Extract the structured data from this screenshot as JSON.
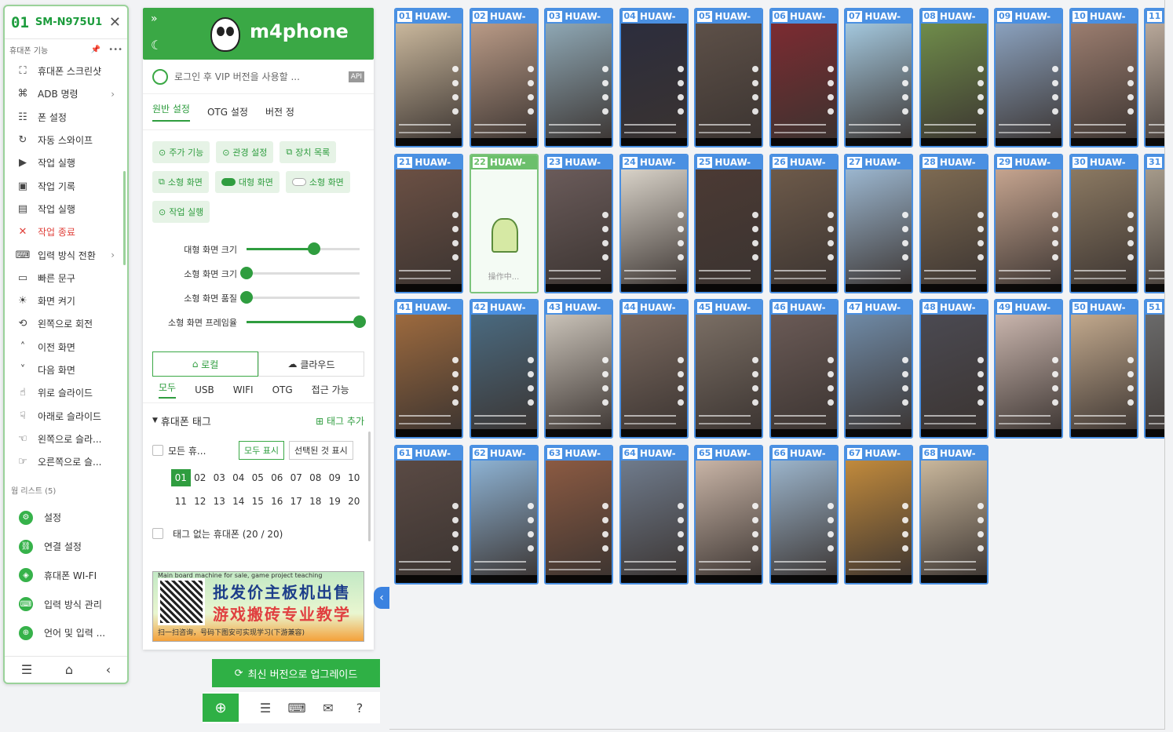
{
  "left_panel": {
    "device_num": "01",
    "device_model": "SM-N975U1",
    "close_icon": "close-icon",
    "subheader": "휴대폰 기능",
    "menu": [
      {
        "label": "휴대폰 스크린샷",
        "icon": "screenshot-icon"
      },
      {
        "label": "ADB 명령",
        "icon": "command-icon",
        "arrow": true
      },
      {
        "label": "폰 설정",
        "icon": "sliders-icon"
      },
      {
        "label": "자동 스와이프",
        "icon": "swipe-icon"
      },
      {
        "label": "작업 실행",
        "icon": "play-icon"
      },
      {
        "label": "작업 기록",
        "icon": "record-icon"
      },
      {
        "label": "작업 실행",
        "icon": "file-icon"
      },
      {
        "label": "작업 종료",
        "icon": "x-icon",
        "danger": true
      },
      {
        "label": "입력 방식 전환",
        "icon": "keyboard-icon",
        "arrow": true
      },
      {
        "label": "빠른 문구",
        "icon": "text-icon"
      },
      {
        "label": "화면 켜기",
        "icon": "sun-icon"
      },
      {
        "label": "왼쪽으로 회전",
        "icon": "rotate-icon"
      },
      {
        "label": "이전 화면",
        "icon": "chevron-up-icon"
      },
      {
        "label": "다음 화면",
        "icon": "chevron-down-icon"
      },
      {
        "label": "위로 슬라이드",
        "icon": "hand-up-icon"
      },
      {
        "label": "아래로 슬라이드",
        "icon": "hand-down-icon"
      },
      {
        "label": "왼쪽으로 슬라...",
        "icon": "hand-left-icon"
      },
      {
        "label": "오른쪽으로 슬...",
        "icon": "hand-right-icon"
      }
    ],
    "section_label": "웜 리스트 (5)",
    "bottom_items": [
      {
        "label": "설정",
        "icon": "gear-icon"
      },
      {
        "label": "연결 설정",
        "icon": "link-icon"
      },
      {
        "label": "휴대폰 WI-FI",
        "icon": "wifi-icon"
      },
      {
        "label": "입력 방식 관리",
        "icon": "keyboard-icon"
      },
      {
        "label": "언어 및 입력 ...",
        "icon": "globe-icon"
      }
    ]
  },
  "mid_panel": {
    "title": "m4phone",
    "login_text": "로그인 후 VIP 버전을 사용할 ...",
    "api_badge": "API",
    "tabs": [
      "원반 설정",
      "OTG 설정",
      "버전 정"
    ],
    "chip_row1": [
      "주가 기능",
      "관경 설정",
      "장치 목록"
    ],
    "chip_row2": [
      "소형 화면",
      "대형 화면",
      "소형 화면"
    ],
    "chip_row3": [
      "작업 실행"
    ],
    "sliders": [
      {
        "label": "대형 화면 크기",
        "value": 0.6
      },
      {
        "label": "소형 화면 크기",
        "value": 0.0
      },
      {
        "label": "소형 화면 품질",
        "value": 0.0
      },
      {
        "label": "소형 화면 프레임율",
        "value": 1.0
      }
    ],
    "segment": [
      "로컬",
      "클라우드"
    ],
    "conn_tabs": [
      "모두",
      "USB",
      "WIFI",
      "OTG",
      "접근 가능"
    ],
    "tag_header": "휴대폰 태그",
    "tag_add": "태그 추가",
    "all_phones": "모든 휴...",
    "show_all": "모두 표시",
    "show_selected": "선택된 것 표시",
    "numbers": [
      "01",
      "02",
      "03",
      "04",
      "05",
      "06",
      "07",
      "08",
      "09",
      "10",
      "11",
      "12",
      "13",
      "14",
      "15",
      "16",
      "17",
      "18",
      "19",
      "20"
    ],
    "no_tag": "태그 없는 휴대폰 (20 / 20)",
    "ad": {
      "line0": "Main board machine for sale, game project teaching",
      "line1": "批发价主板机出售",
      "line2": "游戏搬砖专业教学",
      "line3": "扫一扫咨询，号码下图安可实现学习(下游兼容)"
    },
    "upgrade": "최신 버전으로 업그레이드"
  },
  "grid": {
    "label": "HUAW-",
    "rows": [
      [
        "01",
        "02",
        "03",
        "04",
        "05",
        "06",
        "07",
        "08",
        "09",
        "10",
        "11"
      ],
      [
        "21",
        "22",
        "23",
        "24",
        "25",
        "26",
        "27",
        "28",
        "29",
        "30",
        "31"
      ],
      [
        "41",
        "42",
        "43",
        "44",
        "45",
        "46",
        "47",
        "48",
        "49",
        "50",
        "51"
      ],
      [
        "61",
        "62",
        "63",
        "64",
        "65",
        "66",
        "67",
        "68"
      ]
    ],
    "selected": "22",
    "operating_text": "操作中...",
    "accent": "#4a90e2"
  }
}
